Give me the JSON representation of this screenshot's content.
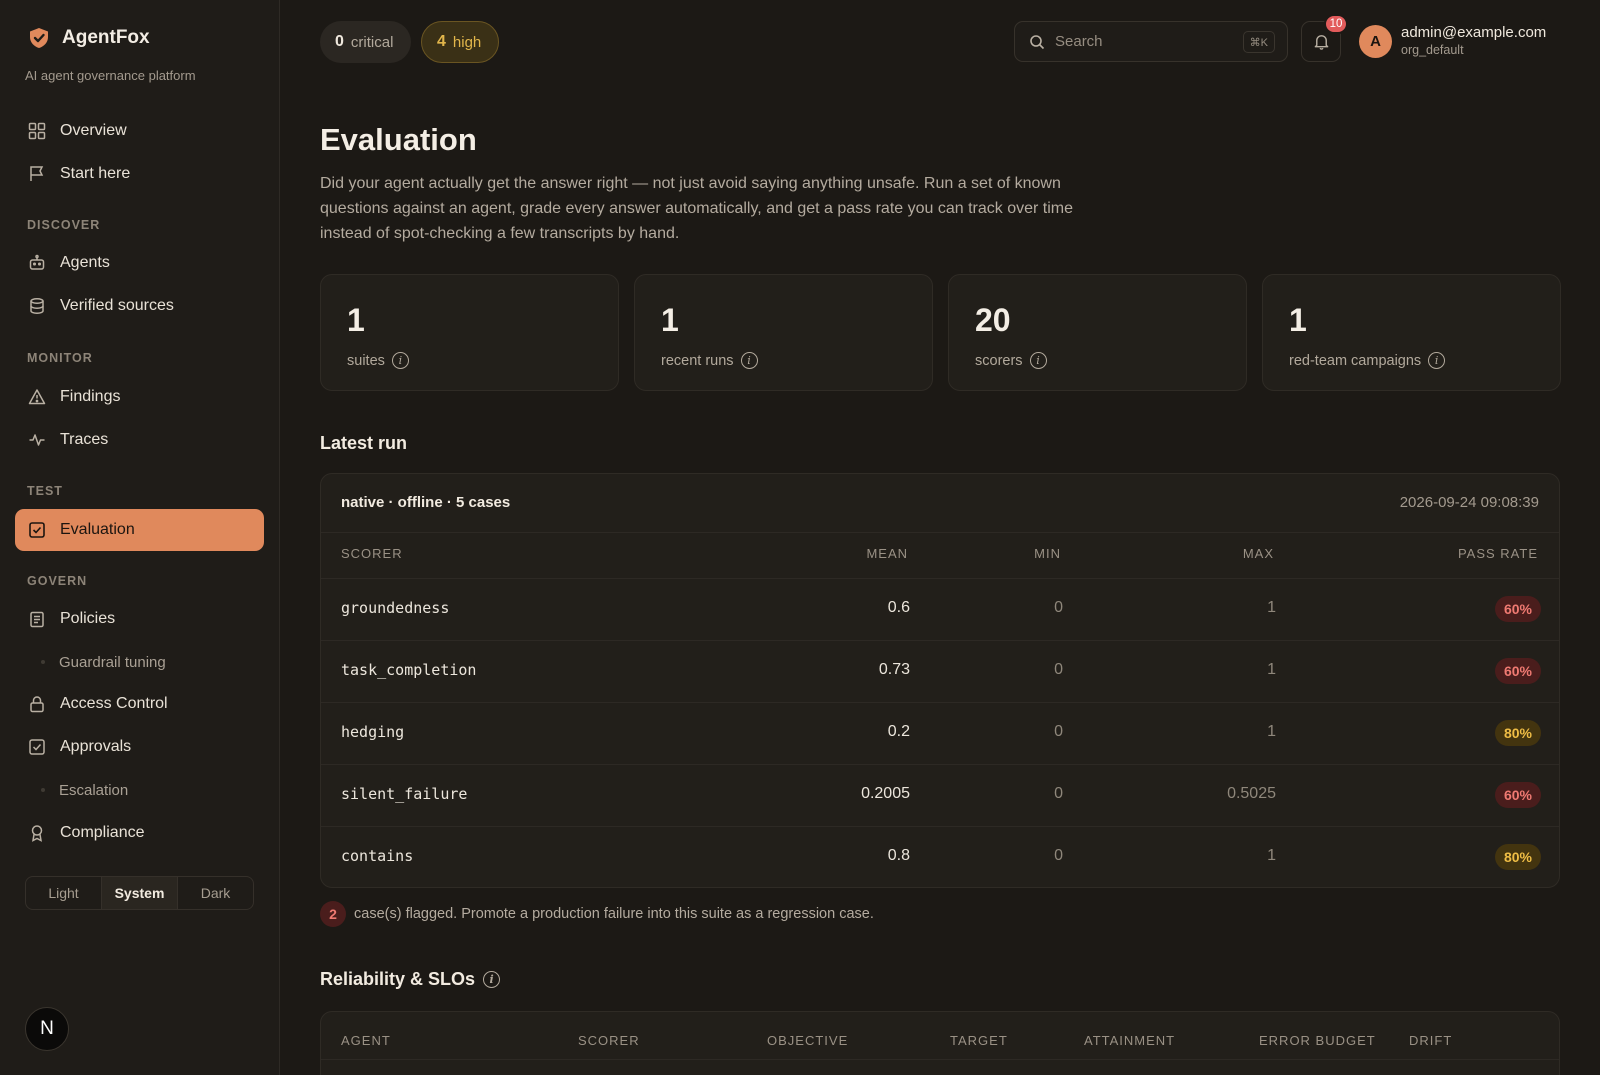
{
  "app": {
    "name": "AgentFox",
    "tagline": "AI agent governance platform",
    "brand_color": "#e0895c"
  },
  "sidebar": {
    "overview": "Overview",
    "start_here": "Start here",
    "discover_label": "DISCOVER",
    "agents": "Agents",
    "verified_sources": "Verified sources",
    "monitor_label": "MONITOR",
    "findings": "Findings",
    "traces": "Traces",
    "test_label": "TEST",
    "evaluation": "Evaluation",
    "govern_label": "GOVERN",
    "policies": "Policies",
    "guardrail_tuning": "Guardrail tuning",
    "access_control": "Access Control",
    "approvals": "Approvals",
    "escalation": "Escalation",
    "compliance": "Compliance",
    "theme": {
      "light": "Light",
      "system": "System",
      "dark": "Dark",
      "selected": "System"
    },
    "dev_badge": "N"
  },
  "topbar": {
    "critical_count": "0",
    "critical_label": "critical",
    "high_count": "4",
    "high_label": "high",
    "search_placeholder": "Search",
    "search_shortcut": "⌘K",
    "notification_count": "10",
    "avatar_initial": "A",
    "user_email": "admin@example.com",
    "user_org": "org_default"
  },
  "page": {
    "title": "Evaluation",
    "description": "Did your agent actually get the answer right — not just avoid saying anything unsafe. Run a set of known questions against an agent, grade every answer automatically, and get a pass rate you can track over time instead of spot-checking a few transcripts by hand."
  },
  "stats": [
    {
      "value": "1",
      "label": "suites"
    },
    {
      "value": "1",
      "label": "recent runs"
    },
    {
      "value": "20",
      "label": "scorers"
    },
    {
      "value": "1",
      "label": "red-team campaigns"
    }
  ],
  "latest_run": {
    "section_title": "Latest run",
    "header": "native · offline · 5 cases",
    "timestamp": "2026-09-24 09:08:39",
    "columns": {
      "scorer": "SCORER",
      "mean": "MEAN",
      "min": "MIN",
      "max": "MAX",
      "pass_rate": "PASS RATE"
    },
    "rows": [
      {
        "scorer": "groundedness",
        "mean": "0.6",
        "min": "0",
        "max": "1",
        "pass_rate": "60%",
        "status": "red"
      },
      {
        "scorer": "task_completion",
        "mean": "0.73",
        "min": "0",
        "max": "1",
        "pass_rate": "60%",
        "status": "red"
      },
      {
        "scorer": "hedging",
        "mean": "0.2",
        "min": "0",
        "max": "1",
        "pass_rate": "80%",
        "status": "amber"
      },
      {
        "scorer": "silent_failure",
        "mean": "0.2005",
        "min": "0",
        "max": "0.5025",
        "pass_rate": "60%",
        "status": "red"
      },
      {
        "scorer": "contains",
        "mean": "0.8",
        "min": "0",
        "max": "1",
        "pass_rate": "80%",
        "status": "amber"
      }
    ],
    "flagged_count": "2",
    "flagged_text": "case(s) flagged. Promote a production failure into this suite as a regression case."
  },
  "reliability": {
    "section_title": "Reliability & SLOs",
    "columns": {
      "agent": "AGENT",
      "scorer": "SCORER",
      "objective": "OBJECTIVE",
      "target": "TARGET",
      "attainment": "ATTAINMENT",
      "error_budget": "ERROR BUDGET",
      "drift": "DRIFT"
    }
  }
}
